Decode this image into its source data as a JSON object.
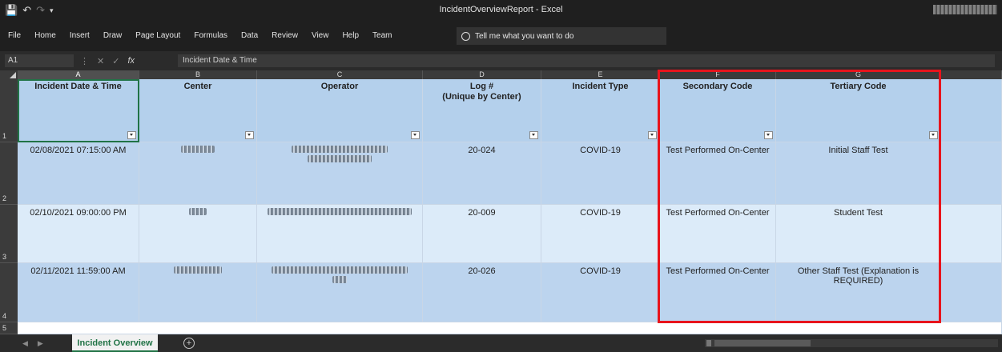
{
  "window": {
    "title": "IncidentOverviewReport  -  Excel",
    "qat": {
      "save_icon": "save-icon",
      "undo_icon": "undo-icon",
      "redo_icon": "redo-icon"
    }
  },
  "ribbon": {
    "tabs": [
      "File",
      "Home",
      "Insert",
      "Draw",
      "Page Layout",
      "Formulas",
      "Data",
      "Review",
      "View",
      "Help",
      "Team"
    ],
    "tell_me": "Tell me what you want to do"
  },
  "formula_bar": {
    "name_box": "A1",
    "fx": "fx",
    "content": "Incident Date & Time"
  },
  "grid": {
    "columns": [
      "A",
      "B",
      "C",
      "D",
      "E",
      "F",
      "G"
    ],
    "rows": [
      "1",
      "2",
      "3",
      "4",
      "5"
    ],
    "headers": [
      "Incident Date & Time",
      "Center",
      "Operator",
      "Log #\n(Unique by Center)",
      "Incident Type",
      "Secondary Code",
      "Tertiary Code"
    ],
    "data": [
      {
        "date": "02/08/2021 07:15:00 AM",
        "log": "20-024",
        "type": "COVID-19",
        "secondary": "Test Performed On-Center",
        "tertiary": "Initial Staff Test"
      },
      {
        "date": "02/10/2021 09:00:00 PM",
        "log": "20-009",
        "type": "COVID-19",
        "secondary": "Test Performed On-Center",
        "tertiary": "Student Test"
      },
      {
        "date": "02/11/2021 11:59:00 AM",
        "log": "20-026",
        "type": "COVID-19",
        "secondary": "Test Performed On-Center",
        "tertiary": "Other Staff Test (Explanation is REQUIRED)"
      }
    ]
  },
  "sheets": {
    "active": "Incident Overview",
    "add_icon": "plus-circle-icon"
  },
  "colors": {
    "accent": "#217346",
    "highlight_box": "#e8141c",
    "header_fill": "#b4d0ec"
  }
}
